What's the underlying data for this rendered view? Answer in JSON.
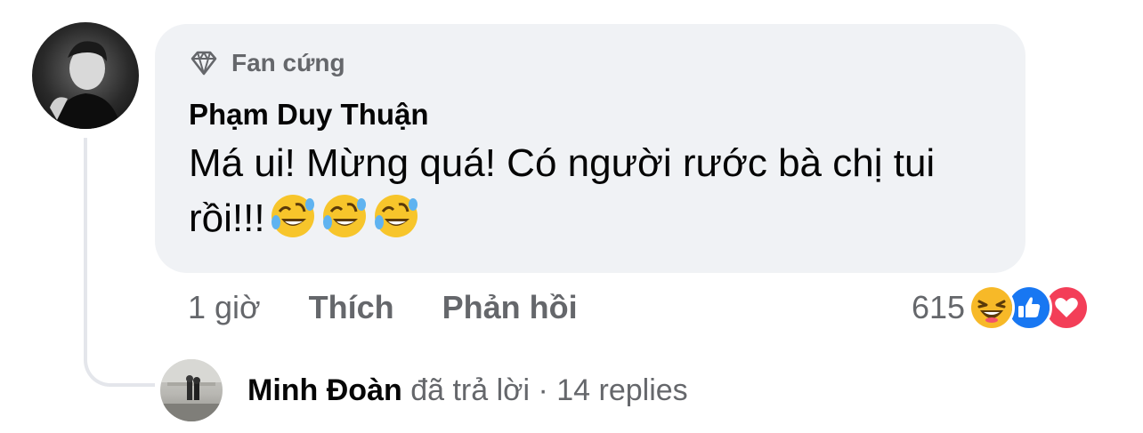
{
  "comment": {
    "badge": "Fan cứng",
    "badge_icon": "diamond-icon",
    "author": "Phạm Duy Thuận",
    "text": "Má ui! Mừng quá! Có người rước bà chị tui rồi!!!",
    "emojis": [
      "rolling-on-floor-laughing-emoji",
      "rolling-on-floor-laughing-emoji",
      "rolling-on-floor-laughing-emoji"
    ]
  },
  "actions": {
    "time": "1 giờ",
    "like_label": "Thích",
    "reply_label": "Phản hồi"
  },
  "reactions": {
    "count": "615",
    "icons": [
      "haha-reaction-icon",
      "like-reaction-icon",
      "love-reaction-icon"
    ],
    "colors": {
      "haha": "#f7b928",
      "like": "#1877f2",
      "love": "#f33e58"
    }
  },
  "reply": {
    "name": "Minh Đoàn",
    "action": " đã trả lời",
    "separator": " · ",
    "count_label": "14 replies"
  },
  "colors": {
    "bubble": "#f0f2f5",
    "secondary_text": "#65676b",
    "primary_text": "#050505",
    "thread_line": "#e4e6eb"
  }
}
